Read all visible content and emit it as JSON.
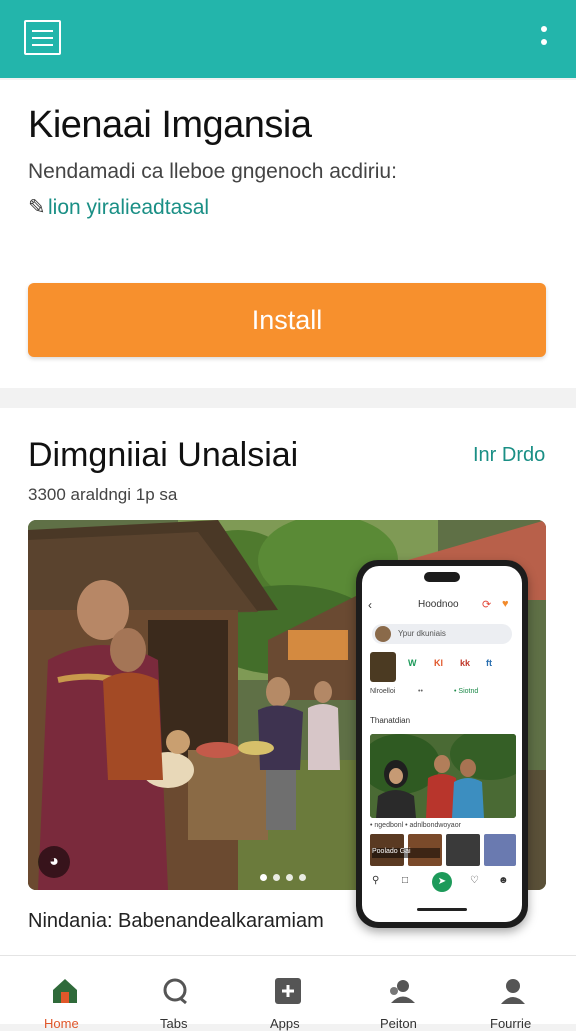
{
  "colors": {
    "header": "#23b5ab",
    "accent": "#1a8f85",
    "install": "#f7902d",
    "nav_active": "#e0572a"
  },
  "header": {
    "menu_icon": "hamburger-icon",
    "more_icon": "more-vertical-icon"
  },
  "app": {
    "title": "Kienaai Imgansia",
    "subtitle": "Nendamadi  ca lleboe gngenoch  acdiriu:",
    "developer": "lion yiralieadtasal",
    "install_label": "Install"
  },
  "section": {
    "title": "Dimgniiai Unalsiai",
    "link": "Inr Drdo",
    "meta": "3300 araldngi 1p sa",
    "carousel_total": 4,
    "carousel_active": 1
  },
  "phone": {
    "title": "Hoodnoo",
    "search": "Ypur dkuniais",
    "tags": [
      "W",
      "Kl",
      "kk",
      "ft"
    ],
    "sub_left": "Nlroelloi",
    "sub_mid": "••",
    "sub_right": "• Siotnd",
    "section_label": "Thanatdian",
    "caption": "• ngedbonl  •  adnlbondwoyaor",
    "strip_caption": "Poolado Gai"
  },
  "caption": "Nindania: Babenandealkaramiam",
  "bottom_nav": [
    {
      "icon": "home-icon",
      "label": "Home"
    },
    {
      "icon": "chat-icon",
      "label": "Tabs"
    },
    {
      "icon": "apps-icon",
      "label": "Apps"
    },
    {
      "icon": "people-icon",
      "label": "Peiton"
    },
    {
      "icon": "profile-icon",
      "label": "Fourrie"
    }
  ]
}
